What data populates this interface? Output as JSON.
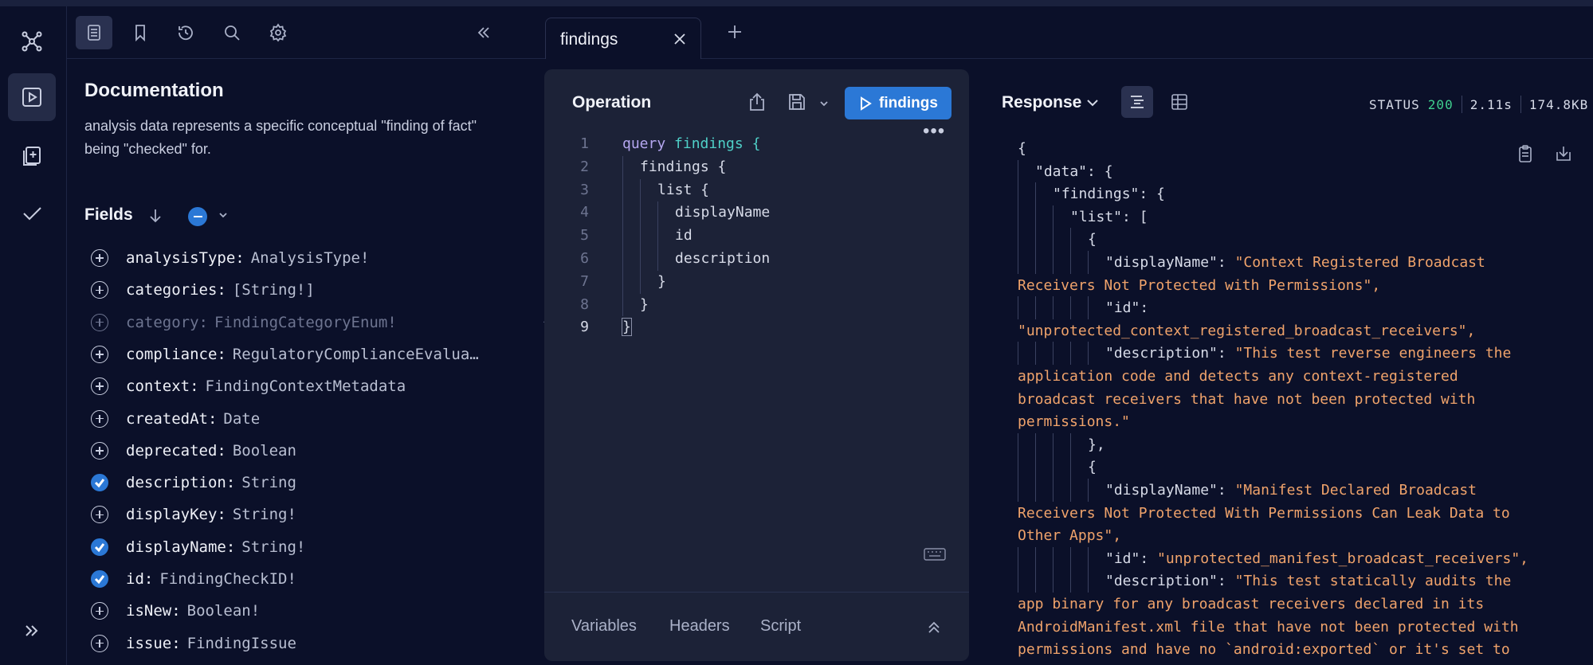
{
  "rail": {
    "items": [
      "graph-icon",
      "play-icon",
      "collections-icon",
      "check-icon"
    ],
    "expand": "chevrons-right-icon"
  },
  "docs": {
    "toolbar": [
      "docs-icon",
      "bookmark-icon",
      "history-icon",
      "search-icon",
      "settings-icon",
      "collapse-icon"
    ],
    "title": "Documentation",
    "description": "analysis data represents a specific conceptual \"finding of fact\" being \"checked\" for.",
    "fields_label": "Fields",
    "fields": [
      {
        "name": "analysisType:",
        "type": "AnalysisType!",
        "checked": false,
        "dim": false
      },
      {
        "name": "categories:",
        "type": "[String!]",
        "checked": false,
        "dim": false
      },
      {
        "name": "category:",
        "type": "FindingCategoryEnum!",
        "checked": false,
        "dim": true
      },
      {
        "name": "compliance:",
        "type": "RegulatoryComplianceEvalua…",
        "checked": false,
        "dim": false
      },
      {
        "name": "context:",
        "type": "FindingContextMetadata",
        "checked": false,
        "dim": false
      },
      {
        "name": "createdAt:",
        "type": "Date",
        "checked": false,
        "dim": false
      },
      {
        "name": "deprecated:",
        "type": "Boolean",
        "checked": false,
        "dim": false
      },
      {
        "name": "description:",
        "type": "String",
        "checked": true,
        "dim": false
      },
      {
        "name": "displayKey:",
        "type": "String!",
        "checked": false,
        "dim": false
      },
      {
        "name": "displayName:",
        "type": "String!",
        "checked": true,
        "dim": false
      },
      {
        "name": "id:",
        "type": "FindingCheckID!",
        "checked": true,
        "dim": false
      },
      {
        "name": "isNew:",
        "type": "Boolean!",
        "checked": false,
        "dim": false
      },
      {
        "name": "issue:",
        "type": "FindingIssue",
        "checked": false,
        "dim": false
      }
    ]
  },
  "tabs": {
    "active": "findings",
    "add": "+"
  },
  "operation": {
    "title": "Operation",
    "run_label": "findings",
    "lines": [
      {
        "n": "1",
        "text": "findings {"
      },
      {
        "n": "2",
        "text": "findings {"
      },
      {
        "n": "3",
        "text": "list {"
      },
      {
        "n": "4",
        "text": "displayName"
      },
      {
        "n": "5",
        "text": "id"
      },
      {
        "n": "6",
        "text": "description"
      },
      {
        "n": "7",
        "text": "}"
      },
      {
        "n": "8",
        "text": "}"
      },
      {
        "n": "9",
        "text": "}"
      }
    ],
    "keyword": "query",
    "footer": {
      "variables": "Variables",
      "headers": "Headers",
      "script": "Script"
    }
  },
  "response": {
    "title": "Response",
    "status_label": "STATUS",
    "status_code": "200",
    "time": "2.11s",
    "size": "174.8KB",
    "lines": [
      {
        "g": 0,
        "t": "{",
        "s": ""
      },
      {
        "g": 1,
        "t": "\"data\": {",
        "s": ""
      },
      {
        "g": 2,
        "t": "\"findings\": {",
        "s": ""
      },
      {
        "g": 3,
        "t": "\"list\": [",
        "s": ""
      },
      {
        "g": 4,
        "t": "{",
        "s": ""
      },
      {
        "g": 5,
        "t": "\"displayName\": ",
        "s": "\"Context Registered Broadcast"
      },
      {
        "g": 0,
        "t": "",
        "s": "Receivers Not Protected with Permissions\","
      },
      {
        "g": 5,
        "t": "\"id\":",
        "s": ""
      },
      {
        "g": 0,
        "t": "",
        "s": "\"unprotected_context_registered_broadcast_receivers\","
      },
      {
        "g": 5,
        "t": "\"description\": ",
        "s": "\"This test reverse engineers the"
      },
      {
        "g": 0,
        "t": "",
        "s": "application code and detects any context-registered"
      },
      {
        "g": 0,
        "t": "",
        "s": "broadcast receivers that have not been protected with"
      },
      {
        "g": 0,
        "t": "",
        "s": "permissions.\""
      },
      {
        "g": 4,
        "t": "},",
        "s": ""
      },
      {
        "g": 4,
        "t": "{",
        "s": ""
      },
      {
        "g": 5,
        "t": "\"displayName\": ",
        "s": "\"Manifest Declared Broadcast"
      },
      {
        "g": 0,
        "t": "",
        "s": "Receivers Not Protected With Permissions Can Leak Data to"
      },
      {
        "g": 0,
        "t": "",
        "s": "Other Apps\","
      },
      {
        "g": 5,
        "t": "\"id\": ",
        "s": "\"unprotected_manifest_broadcast_receivers\","
      },
      {
        "g": 5,
        "t": "\"description\": ",
        "s": "\"This test statically audits the"
      },
      {
        "g": 0,
        "t": "",
        "s": "app binary for any broadcast receivers declared in its"
      },
      {
        "g": 0,
        "t": "",
        "s": "AndroidManifest.xml file that have not been protected with"
      },
      {
        "g": 0,
        "t": "",
        "s": "permissions and have no `android:exported` or it's set to"
      }
    ]
  },
  "colors": {
    "accent": "#2b78d6",
    "background": "#0b1029",
    "panel": "#1c2237",
    "string": "#f0a36b",
    "status_ok": "#3fcf8e"
  }
}
